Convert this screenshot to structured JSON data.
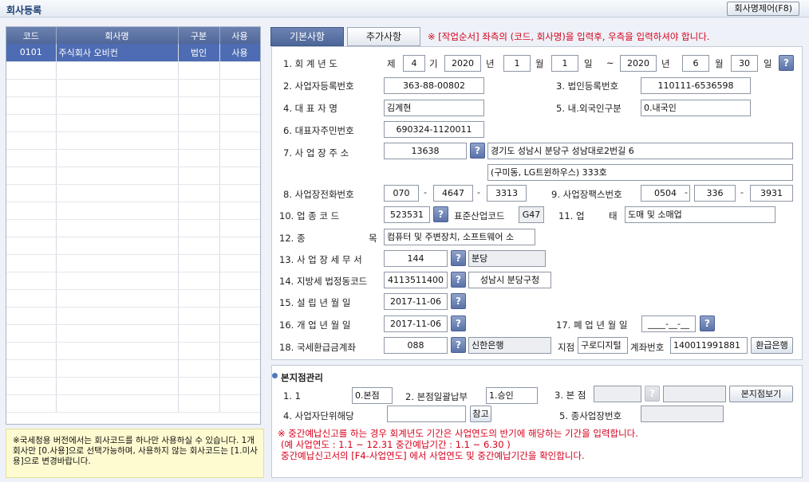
{
  "app": {
    "title": "회사등록",
    "delete_button": "회사명제어(F8)"
  },
  "grid": {
    "headers": [
      "코드",
      "회사명",
      "구분",
      "사용"
    ],
    "rows": [
      {
        "code": "0101",
        "name": "주식회사 오비컨",
        "type": "법인",
        "use": "사용"
      }
    ],
    "empty_rows": 20
  },
  "note": "※국세청용 버전에서는 회사코드를 하나만 사용하실 수 있습니다. 1개 회사만 [0.사용]으로 선택가능하며, 사용하지 않는 회사코드는 [1.미사용]으로 변경바랍니다.",
  "tabs": {
    "basic": "기본사항",
    "additional": "추가사항",
    "warning": "※ [작업순서] 좌측의 (코드, 회사명)을 입력후, 우측을 입력하셔야 합니다."
  },
  "form": {
    "fiscal": {
      "label": "1. 회  계  년  도",
      "je": "제",
      "term": "4",
      "gi": "기",
      "from_year": "2020",
      "year_l": "년",
      "from_month": "1",
      "month_l": "월",
      "from_day": "1",
      "day_l": "일",
      "tilde": "~",
      "to_year": "2020",
      "to_month": "6",
      "to_day": "30"
    },
    "biz_reg": {
      "label": "2. 사업자등록번호",
      "value": "363-88-00802"
    },
    "corp_reg": {
      "label": "3. 법인등록번호",
      "value": "110111-6536598"
    },
    "ceo": {
      "label": "4. 대  표  자  명",
      "value": "김계현"
    },
    "foreign": {
      "label": "5. 내.외국인구분",
      "value": "0.내국인"
    },
    "ceo_id": {
      "label": "6. 대표자주민번호",
      "value": "690324-1120011"
    },
    "address": {
      "label": "7. 사  업  장  주  소",
      "zip": "13638",
      "line1": "경기도 성남시 분당구  성남대로2번길 6",
      "line2": "(구미동, LG트윈하우스) 333호"
    },
    "phone": {
      "label": "8. 사업장전화번호",
      "p1": "070",
      "p2": "4647",
      "p3": "3313"
    },
    "fax": {
      "label": "9. 사업장팩스번호",
      "f1": "0504",
      "f2": "336",
      "f3": "3931"
    },
    "industry": {
      "label": "10. 업    종    코    드",
      "code": "523531",
      "std_label": "표준산업코드",
      "std_code": "G47"
    },
    "business": {
      "label": "11. 업",
      "label2": "태",
      "value": "도매 및 소매업"
    },
    "category": {
      "label": "12. 종",
      "label2": "목",
      "value": "컴퓨터 및 주변장치, 소프트웨어 소"
    },
    "tax_office": {
      "label": "13. 사 업 장 세 무 서",
      "code": "144",
      "name": "분당"
    },
    "local_tax": {
      "label": "14. 지방세 법정동코드",
      "code": "4113511400",
      "name": "성남시 분당구청"
    },
    "established": {
      "label": "15. 설  립  년  월  일",
      "value": "2017-11-06"
    },
    "opened": {
      "label": "16. 개  업  년  월  일",
      "value": "2017-11-06"
    },
    "closed": {
      "label": "17. 폐 업 년 월 일",
      "value": "____-__-__"
    },
    "refund": {
      "label": "18. 국세환급금계좌",
      "bank_code": "088",
      "bank_name": "신한은행",
      "branch_label": "지점",
      "branch": "구로디지털",
      "account_label": "계좌번호",
      "account": "140011991881",
      "refund_bank_btn": "환급은행"
    }
  },
  "hq": {
    "title": "본지점관리",
    "f1_label": "1. 1",
    "f1_value": "0.본점",
    "f2_label": "2. 본점일괄납부",
    "f2_value": "1.승인",
    "f3_label": "3. 본  점",
    "hq_view_btn": "본지점보기",
    "f4_label": "4. 사업자단위해당",
    "ref_btn": "참고",
    "f5_label": "5. 종사업장번호",
    "notes": [
      "※ 중간예납신고를 하는 경우 회계년도 기간은 사업연도의 반기에 해당하는 기간을 입력합니다.",
      "(예 사업연도 : 1.1  ~  12.31  중간예납기간 : 1.1 ~ 6.30 )",
      "중간예납신고서의 [F4-사업연도] 에서 사업연도 및 중간예납기간을 확인합니다."
    ]
  }
}
